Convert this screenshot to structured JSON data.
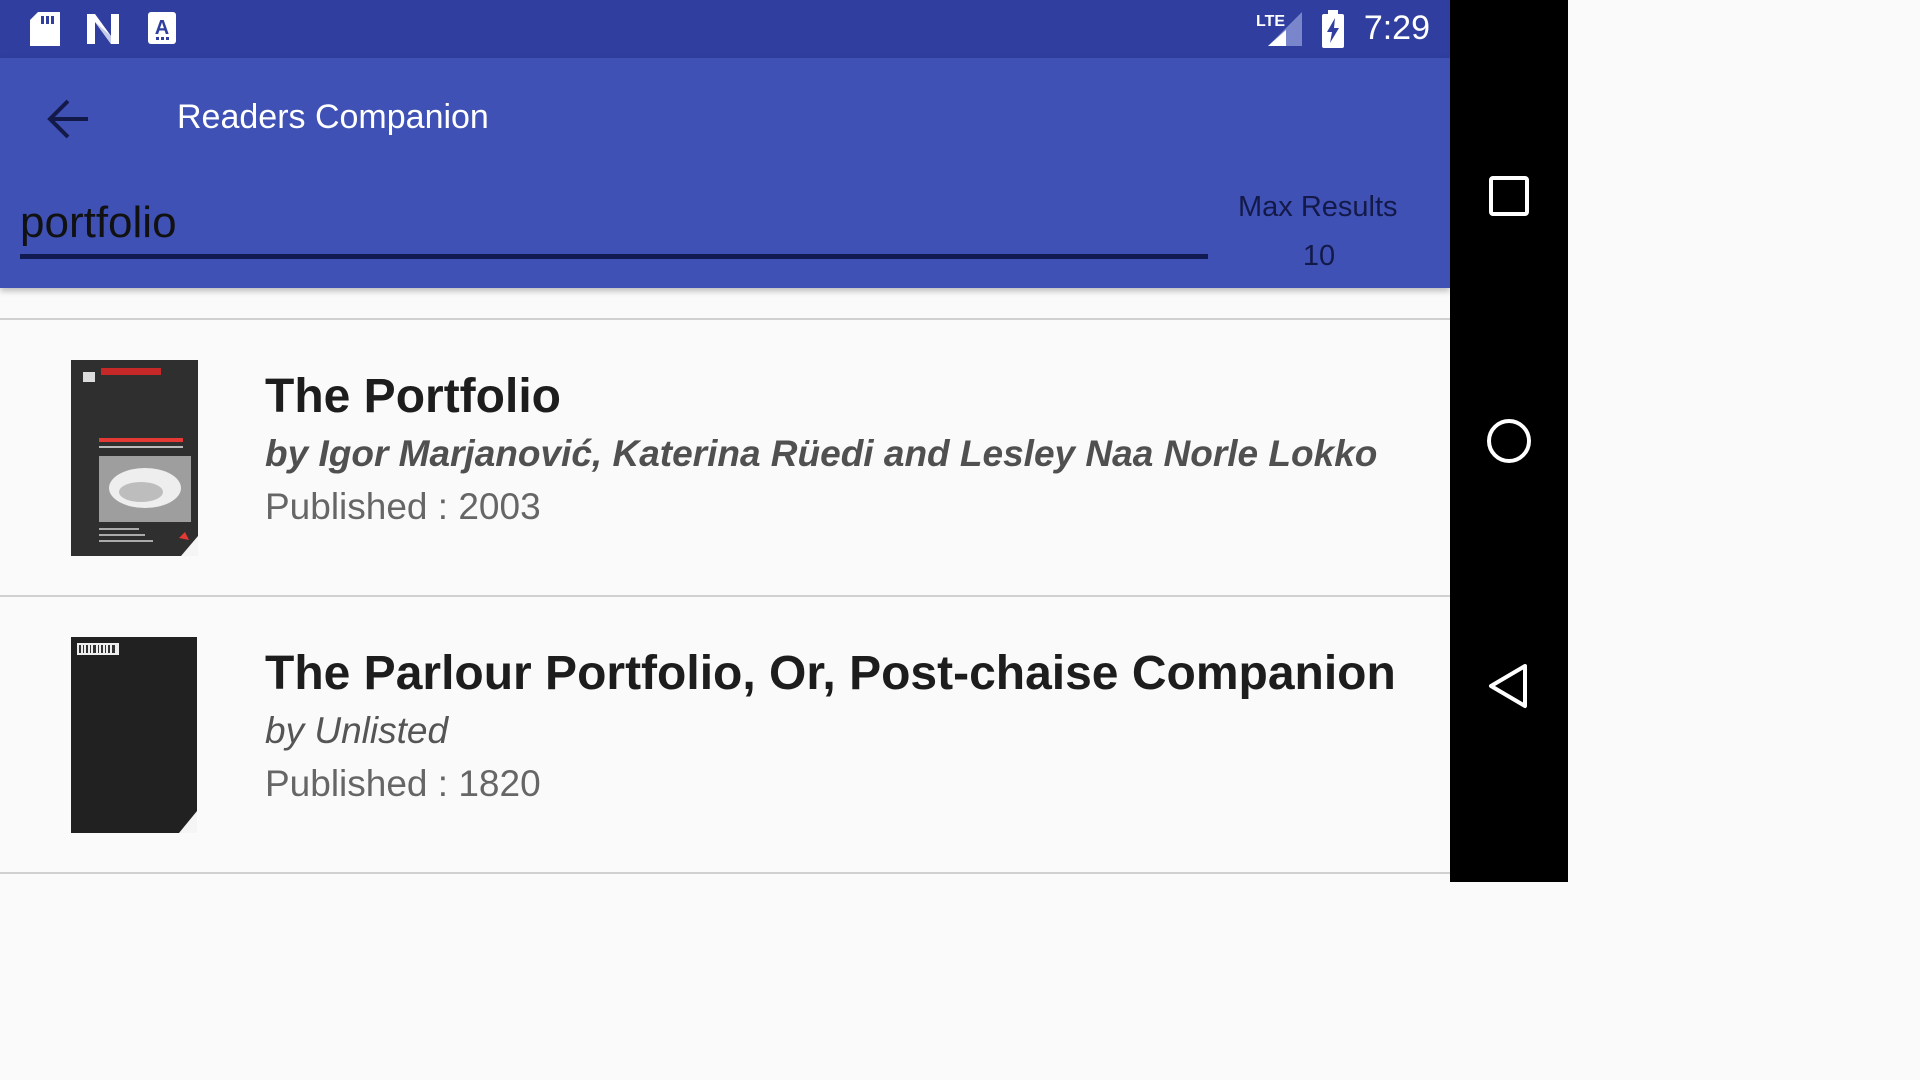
{
  "status_bar": {
    "time": "7:29",
    "icons": [
      "sd-card-icon",
      "n-logo-icon",
      "a-notification-icon",
      "lte-signal-icon",
      "battery-charging-icon"
    ],
    "network_label": "LTE"
  },
  "app_bar": {
    "title": "Readers Companion",
    "back_icon": "arrow-left-icon",
    "search": {
      "value": "portfolio",
      "placeholder": ""
    },
    "max_results": {
      "label": "Max Results",
      "value": "10"
    }
  },
  "results": [
    {
      "title": "The Portfolio",
      "authors": "by Igor Marjanović, Katerina Rüedi and Lesley Naa Norle Lokko",
      "published": "Published : 2003",
      "cover_text": "THE PORTFOLIO"
    },
    {
      "title": "The Parlour Portfolio, Or, Post-chaise Companion",
      "authors": "by Unlisted",
      "published": "Published : 1820"
    }
  ],
  "nav_bar": {
    "icons": [
      "recents-square-icon",
      "home-circle-icon",
      "back-triangle-icon"
    ]
  },
  "colors": {
    "status_bar": "#303f9f",
    "app_bar": "#3f51b5",
    "list_bg": "#fafafa",
    "accent_underline": "#121a52"
  }
}
